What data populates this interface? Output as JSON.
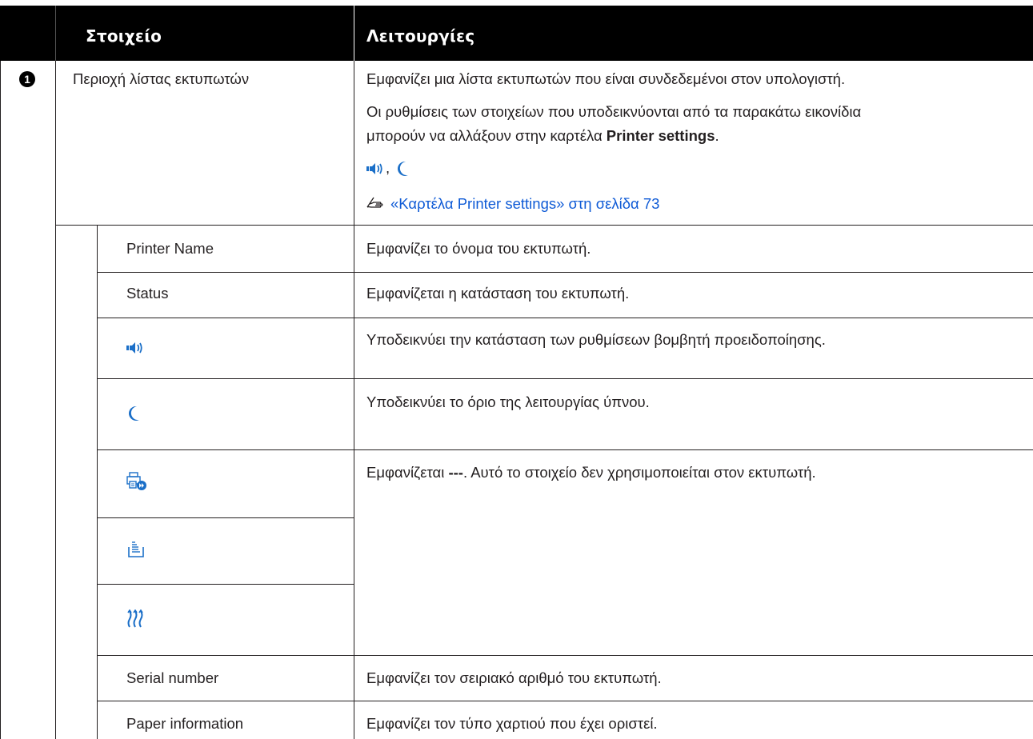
{
  "header": {
    "col_item": "Στοιχείο",
    "col_functions": "Λειτουργίες"
  },
  "section": {
    "number": "1",
    "name": "Περιοχή λίστας εκτυπωτών",
    "desc1": "Εμφανίζει μια λίστα εκτυπωτών που είναι συνδεδεμένοι στον υπολογιστή.",
    "desc2_line1": "Οι ρυθμίσεις των στοιχείων που υποδεικνύονται από τα παρακάτω εικονίδια",
    "desc2_line2_pre": "μπορούν να αλλάξουν στην καρτέλα ",
    "desc2_bold": "Printer settings",
    "desc2_end": ".",
    "icon_sep": ",",
    "link_text": "«Καρτέλα Printer settings» στη σελίδα 73"
  },
  "rows": [
    {
      "item": "Printer Name",
      "desc": "Εμφανίζει το όνομα του εκτυπωτή."
    },
    {
      "item": "Status",
      "desc": "Εμφανίζεται η κατάσταση του εκτυπωτή."
    },
    {
      "icon": "buzzer-speaker-icon",
      "desc": "Υποδεικνύει την κατάσταση των ρυθμίσεων βομβητή προειδοποίησης."
    },
    {
      "icon": "sleep-moon-icon",
      "desc": "Υποδεικνύει το όριο της λειτουργίας ύπνου."
    },
    {
      "icon": "printer-forward-icon",
      "desc_pre": "Εμφανίζεται ",
      "desc_bold": "---",
      "desc_post": ". Αυτό το στοιχείο δεν χρησιμοποιείται στον εκτυπωτή."
    },
    {
      "icon": "paper-stack-icon"
    },
    {
      "icon": "heater-icon"
    },
    {
      "item": "Serial number",
      "desc": "Εμφανίζει τον σειριακό αριθμό του εκτυπωτή."
    },
    {
      "item": "Paper information",
      "desc": "Εμφανίζει τον τύπο χαρτιού που έχει οριστεί."
    }
  ],
  "colors": {
    "icon_blue": "#1b6fc8",
    "link_blue": "#0f5bd6",
    "header_bg": "#000000"
  }
}
